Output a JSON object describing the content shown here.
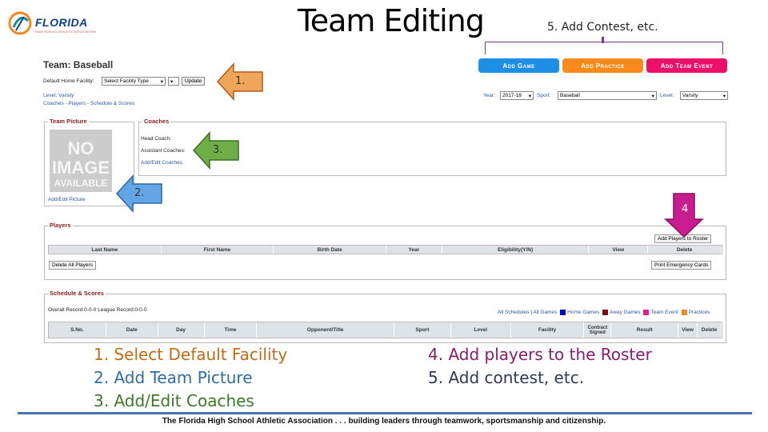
{
  "slide": {
    "title": "Team Editing",
    "logo": {
      "name": "FLORIDA",
      "subtitle": "HIGH SCHOOL ATHLETIC ASSOCIATION"
    },
    "top_callout": "5. Add Contest, etc.",
    "footer": "The Florida High School Athletic Association . . . building leaders through teamwork, sportsmanship and citizenship."
  },
  "buttons": {
    "add_game": "Add Game",
    "add_practice": "Add Practice",
    "add_event": "Add Team Event"
  },
  "team": {
    "name": "Team: Baseball",
    "default_facility_label": "Default Home Facility:",
    "facility_select": "Select Facility Type",
    "update": "Update",
    "level": "Level: Varsity",
    "nav": "Coaches - Players - Schedule & Scores",
    "year_label": "Year:",
    "year_value": "2017-18",
    "sport_label": "Sport:",
    "sport_value": "Baseball",
    "level_label": "Level:",
    "level_value": "Varsity"
  },
  "picture": {
    "legend": "Team Picture",
    "noimg_l1": "NO",
    "noimg_l2": "IMAGE",
    "noimg_l3": "AVAILABLE",
    "link": "Add/Edit Picture"
  },
  "coaches": {
    "legend": "Coaches",
    "head": "Head Coach:",
    "assistant": "Assistant Coaches:",
    "link": "Add/Edit Coaches"
  },
  "players": {
    "legend": "Players",
    "add_button": "Add Players to Roster",
    "columns": [
      "Last Name",
      "First Name",
      "Birth Date",
      "Year",
      "Eligibility(Y/N)",
      "View",
      "Delete"
    ],
    "delete_all": "Delete All Players",
    "print": "Print Emergency Cards"
  },
  "schedule": {
    "legend": "Schedule & Scores",
    "record": "Overall Record:0-0-0 League Record:0-0-0",
    "filter_all": "All Schedules",
    "filter_games": "All Games",
    "legend_home": "Home Games",
    "legend_away": "Away Games",
    "legend_event": "Team Event",
    "legend_practice": "Practices",
    "columns": [
      "S.No.",
      "Date",
      "Day",
      "Time",
      "Opponent/Title",
      "Sport",
      "Level",
      "Facility",
      "Contract Signed",
      "Result",
      "View",
      "Delete"
    ]
  },
  "arrows": {
    "a1": "1.",
    "a2": "2.",
    "a3": "3.",
    "a4": "4"
  },
  "steps_left": [
    "1. Select Default Facility",
    "2. Add Team Picture",
    "3. Add/Edit Coaches"
  ],
  "steps_right": [
    "4. Add players to the Roster",
    "5. Add contest, etc."
  ],
  "colors": {
    "home": "#0000cc",
    "away": "#7a1010",
    "event": "#e81c8a",
    "practice": "#f08a20"
  }
}
